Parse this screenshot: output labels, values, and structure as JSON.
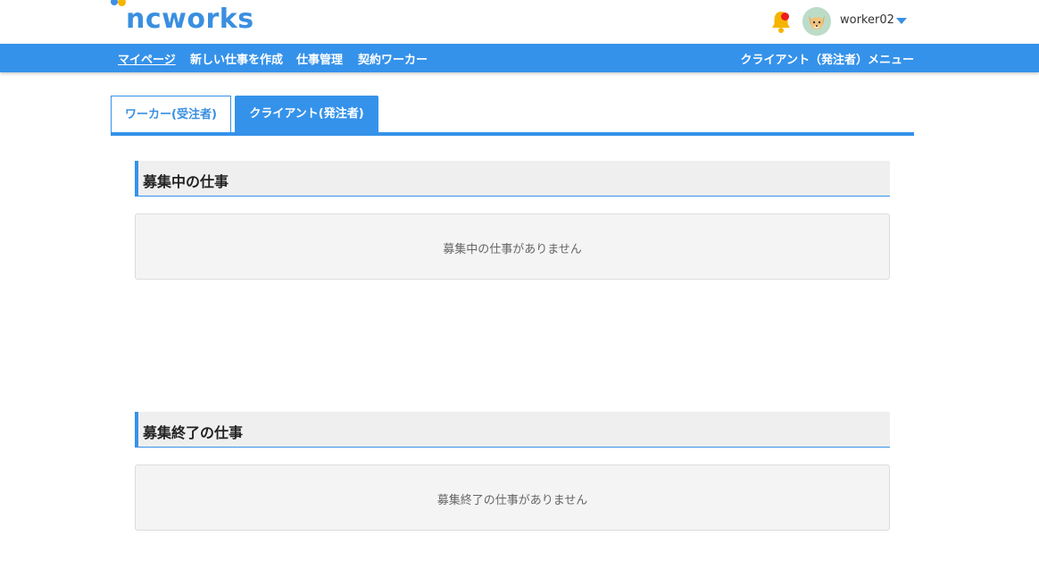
{
  "header": {
    "logo_text": "ncworks",
    "username": "worker02",
    "icons": {
      "notification": "bell-icon",
      "avatar": "fox-avatar",
      "dropdown": "caret-down-icon"
    },
    "colors": {
      "brand": "#3592ea",
      "bell": "#f5b400",
      "notification_dot": "#ee1c1c"
    }
  },
  "nav": {
    "items": [
      {
        "label": "マイページ",
        "active": true
      },
      {
        "label": "新しい仕事を作成",
        "active": false
      },
      {
        "label": "仕事管理",
        "active": false
      },
      {
        "label": "契約ワーカー",
        "active": false
      }
    ],
    "menu_label": "クライアント（発注者）メニュー"
  },
  "tabs": [
    {
      "label": "ワーカー(受注者)",
      "active": false
    },
    {
      "label": "クライアント(発注者)",
      "active": true
    }
  ],
  "sections": [
    {
      "title": "募集中の仕事",
      "empty_message": "募集中の仕事がありません"
    },
    {
      "title": "募集終了の仕事",
      "empty_message": "募集終了の仕事がありません"
    }
  ]
}
